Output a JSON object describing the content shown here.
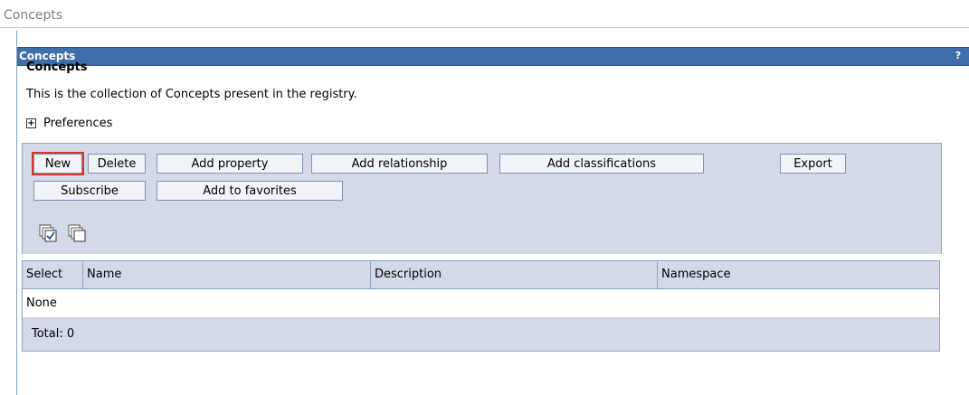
{
  "page": {
    "header": "Concepts"
  },
  "portlet": {
    "title": "Concepts",
    "help": "?"
  },
  "content": {
    "section_title": "Concepts",
    "description": "This is the collection of Concepts present in the registry.",
    "preferences_toggle": "+",
    "preferences_label": "Preferences"
  },
  "toolbar": {
    "new": "New",
    "delete": "Delete",
    "add_property": "Add property",
    "add_relationship": "Add relationship",
    "add_classifications": "Add classifications",
    "export": "Export",
    "subscribe": "Subscribe",
    "add_to_favorites": "Add to favorites"
  },
  "icons": {
    "select_all": "select-all-icon",
    "deselect_all": "deselect-all-icon"
  },
  "table": {
    "columns": [
      "Select",
      "Name",
      "Description",
      "Namespace"
    ],
    "empty_text": "None",
    "total": "Total: 0"
  },
  "colors": {
    "title_bar": "#3f6fab",
    "panel": "#d3d9e6",
    "highlight": "#e0322d"
  }
}
